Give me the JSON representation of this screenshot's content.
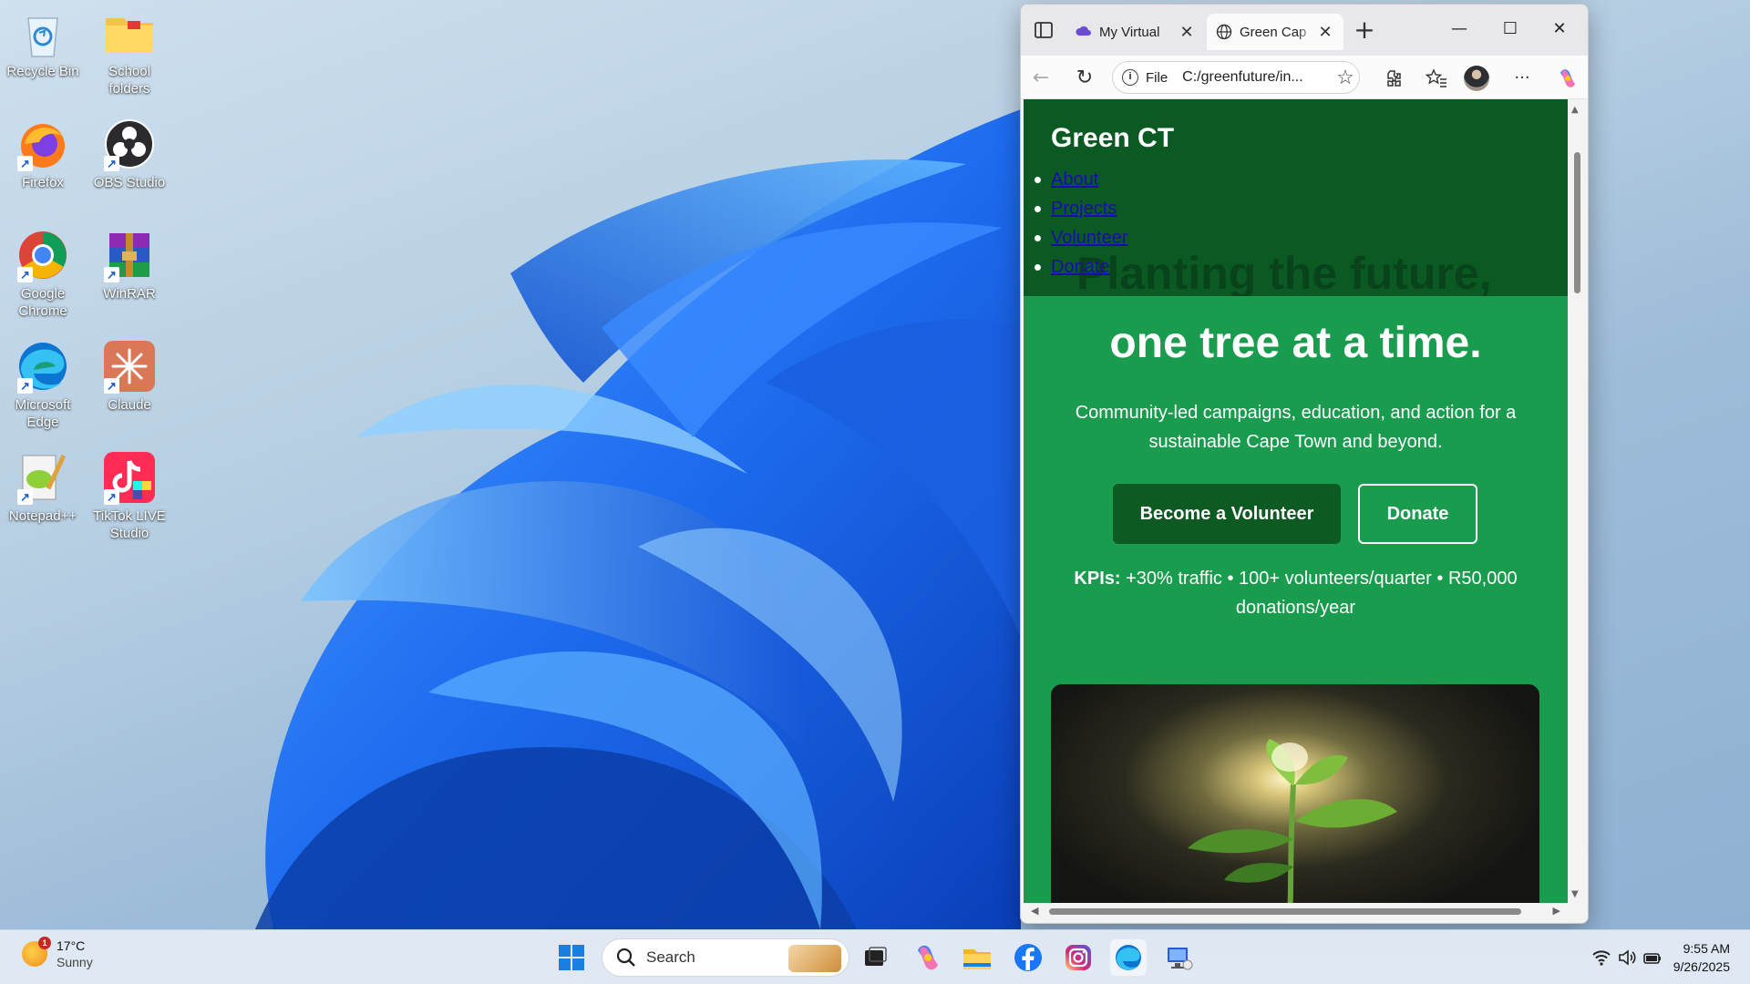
{
  "desktop": {
    "icons": [
      {
        "label": "Recycle Bin"
      },
      {
        "label": "School folders"
      },
      {
        "label": "Firefox"
      },
      {
        "label": "OBS Studio"
      },
      {
        "label": "Google Chrome"
      },
      {
        "label": "WinRAR"
      },
      {
        "label": "Microsoft Edge"
      },
      {
        "label": "Claude"
      },
      {
        "label": "Notepad++"
      },
      {
        "label": "TikTok LIVE Studio"
      }
    ]
  },
  "browser": {
    "tabs": [
      {
        "label": "My Virtual",
        "close": "✕"
      },
      {
        "label": "Green Cap",
        "close": "✕"
      }
    ],
    "new_tab": "+",
    "window_controls": {
      "minimize": "—",
      "maximize": "☐",
      "close": "✕"
    },
    "toolbar": {
      "back": "←",
      "reload": "↻",
      "scheme": "File",
      "url": "C:/greenfuture/in...",
      "favorite": "☆",
      "more": "···"
    }
  },
  "site": {
    "title": "Green CT",
    "nav": [
      "About",
      "Projects",
      "Volunteer",
      "Donate"
    ],
    "obscured_heading": "Planting the future,",
    "hero_heading": "one tree at a time.",
    "hero_subtitle": "Community-led campaigns, education, and action for a sustainable Cape Town and beyond.",
    "buttons": {
      "volunteer": "Become a Volunteer",
      "donate": "Donate"
    },
    "kpis_label": "KPIs:",
    "kpis_text": "+30% traffic • 100+ volunteers/quarter • R50,000 donations/year"
  },
  "taskbar": {
    "weather": {
      "temperature": "17°C",
      "condition": "Sunny",
      "badge": "1"
    },
    "search_placeholder": "Search",
    "clock": {
      "time": "9:55 AM",
      "date": "9/26/2025"
    }
  },
  "colors": {
    "header_green": "#0b5a24",
    "hero_green": "#1a9c4e",
    "button_green": "#0d5a22",
    "link_blue": "#1a0dab"
  }
}
